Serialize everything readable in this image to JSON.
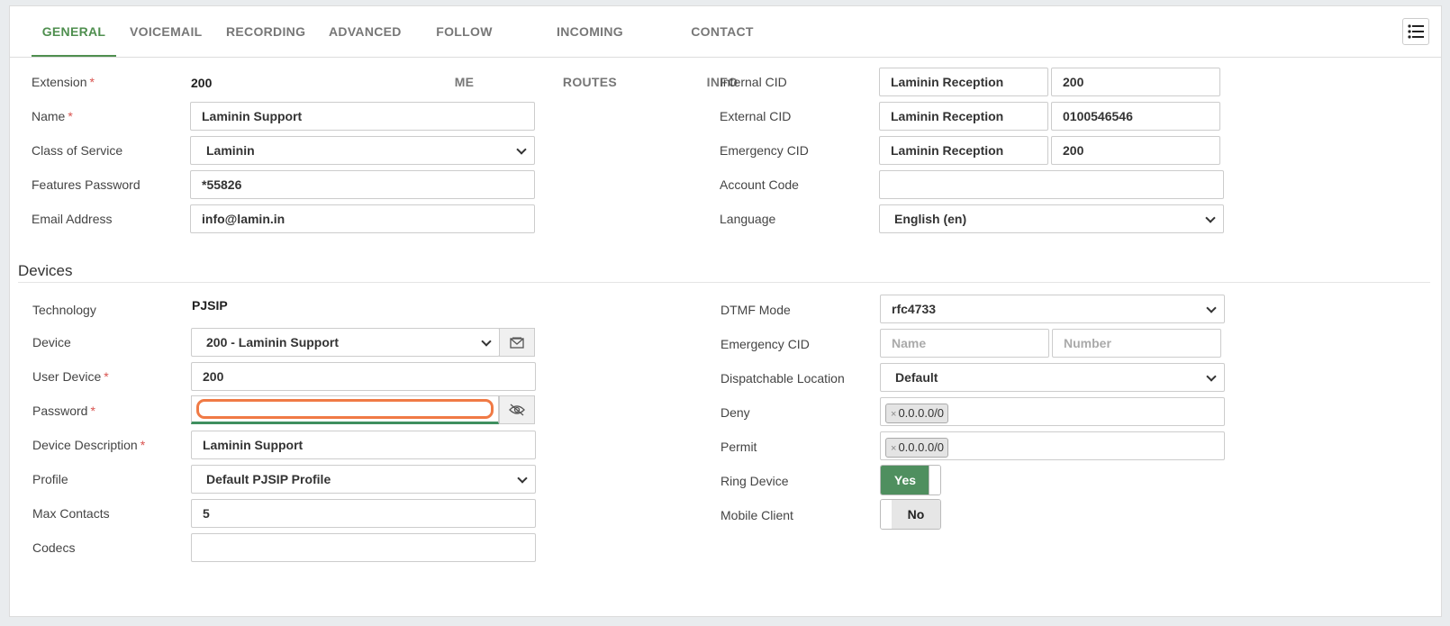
{
  "tabs": [
    "GENERAL",
    "VOICEMAIL",
    "RECORDING",
    "ADVANCED",
    "FOLLOW ME",
    "INCOMING ROUTES",
    "CONTACT INFO"
  ],
  "general": {
    "extension_label": "Extension",
    "extension_value": "200",
    "name_label": "Name",
    "name_value": "Laminin Support",
    "cos_label": "Class of Service",
    "cos_value": "Laminin",
    "features_pw_label": "Features Password",
    "features_pw_value": "*55826",
    "email_label": "Email Address",
    "email_value": "info@lamin.in",
    "internal_cid_label": "Internal CID",
    "internal_cid_name": "Laminin Reception",
    "internal_cid_number": "200",
    "external_cid_label": "External CID",
    "external_cid_name": "Laminin Reception",
    "external_cid_number": "0100546546",
    "emergency_cid_label": "Emergency CID",
    "emergency_cid_name": "Laminin Reception",
    "emergency_cid_number": "200",
    "account_code_label": "Account Code",
    "account_code_value": "",
    "language_label": "Language",
    "language_value": "English (en)"
  },
  "devices": {
    "title": "Devices",
    "technology_label": "Technology",
    "technology_value": "PJSIP",
    "device_label": "Device",
    "device_value": "200 - Laminin Support",
    "user_device_label": "User Device",
    "user_device_value": "200",
    "password_label": "Password",
    "password_value": "",
    "description_label": "Device Description",
    "description_value": "Laminin Support",
    "profile_label": "Profile",
    "profile_value": "Default PJSIP Profile",
    "max_contacts_label": "Max Contacts",
    "max_contacts_value": "5",
    "codecs_label": "Codecs",
    "codecs_value": "",
    "dtmf_label": "DTMF Mode",
    "dtmf_value": "rfc4733",
    "emergency_cid_label": "Emergency CID",
    "emergency_name_placeholder": "Name",
    "emergency_number_placeholder": "Number",
    "dispatchable_label": "Dispatchable Location",
    "dispatchable_value": "Default",
    "deny_label": "Deny",
    "deny_tag": "0.0.0.0/0",
    "permit_label": "Permit",
    "permit_tag": "0.0.0.0/0",
    "ring_device_label": "Ring Device",
    "ring_device_value": "Yes",
    "mobile_client_label": "Mobile Client",
    "mobile_client_value": "No"
  },
  "icons": {
    "menu": "list-icon",
    "device_link": "envelope-icon",
    "password_toggle": "eye-slash-icon"
  },
  "colors": {
    "accent": "#4f8f5f",
    "required": "#d9534f",
    "focus": "#f07a45"
  }
}
